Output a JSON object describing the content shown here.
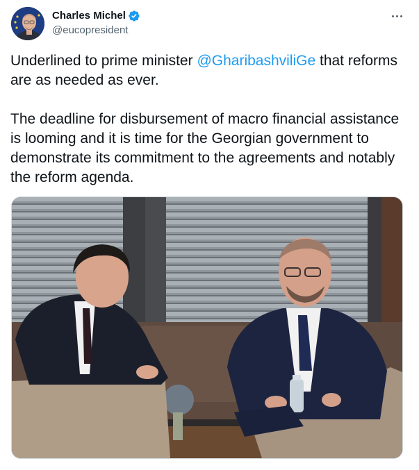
{
  "author": {
    "display_name": "Charles Michel",
    "handle": "@eucopresident",
    "verified": true,
    "avatar_icon": "person-avatar-eu-flag"
  },
  "menu": {
    "icon": "more-horizontal-icon"
  },
  "tweet": {
    "paragraph1_before": "Underlined to prime minister ",
    "mention": "@GharibashviliGe",
    "paragraph1_after": " that reforms are as needed as ever.",
    "paragraph2": "The deadline for disbursement of macro financial assistance is looming and it is time for the Georgian government to demonstrate its commitment to the agreements and notably the reform agenda."
  },
  "colors": {
    "mention": "#1d9bf0",
    "verified": "#1d9bf0",
    "secondary_text": "#536471"
  },
  "media": {
    "type": "photo",
    "icon": "photo-two-men-meeting"
  }
}
